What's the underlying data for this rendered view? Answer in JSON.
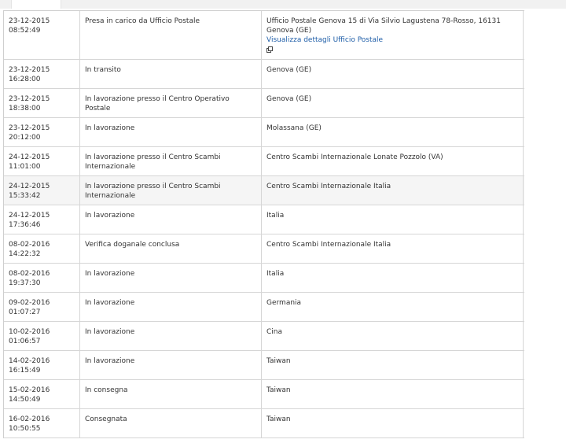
{
  "tracking": {
    "rows": [
      {
        "date": "23-12-2015",
        "time": "08:52:49",
        "status": "Presa in carico da Ufficio Postale",
        "place": "Ufficio Postale Genova 15 di Via Silvio Lagustena 78-Rosso, 16131 Genova (GE)",
        "link": "Visualizza dettagli Ufficio Postale"
      },
      {
        "date": "23-12-2015",
        "time": "16:28:00",
        "status": "In transito",
        "place": "Genova (GE)"
      },
      {
        "date": "23-12-2015",
        "time": "18:38:00",
        "status": "In lavorazione presso il Centro Operativo Postale",
        "place": "Genova (GE)"
      },
      {
        "date": "23-12-2015",
        "time": "20:12:00",
        "status": "In lavorazione",
        "place": "Molassana (GE)"
      },
      {
        "date": "24-12-2015",
        "time": "11:01:00",
        "status": "In lavorazione presso il Centro Scambi Internazionale",
        "place": "Centro Scambi Internazionale Lonate Pozzolo (VA)"
      },
      {
        "date": "24-12-2015",
        "time": "15:33:42",
        "status": "In lavorazione presso il Centro Scambi Internazionale",
        "place": "Centro Scambi Internazionale Italia"
      },
      {
        "date": "24-12-2015",
        "time": "17:36:46",
        "status": "In lavorazione",
        "place": "Italia"
      },
      {
        "date": "08-02-2016",
        "time": "14:22:32",
        "status": "Verifica doganale conclusa",
        "place": "Centro Scambi Internazionale Italia"
      },
      {
        "date": "08-02-2016",
        "time": "19:37:30",
        "status": "In lavorazione",
        "place": "Italia"
      },
      {
        "date": "09-02-2016",
        "time": "01:07:27",
        "status": "In lavorazione",
        "place": "Germania"
      },
      {
        "date": "10-02-2016",
        "time": "01:06:57",
        "status": "In lavorazione",
        "place": "Cina"
      },
      {
        "date": "14-02-2016",
        "time": "16:15:49",
        "status": "In lavorazione",
        "place": "Taiwan"
      },
      {
        "date": "15-02-2016",
        "time": "14:50:49",
        "status": "In consegna",
        "place": "Taiwan"
      },
      {
        "date": "16-02-2016",
        "time": "10:50:55",
        "status": "Consegnata",
        "place": "Taiwan"
      }
    ],
    "highlight_row": 5,
    "colors": {
      "link": "#1f5ea8",
      "text": "#333333",
      "border": "#d6d6d6",
      "row_highlight": "#f5f5f5"
    },
    "icons": {
      "external_link": "external-link-icon"
    }
  }
}
